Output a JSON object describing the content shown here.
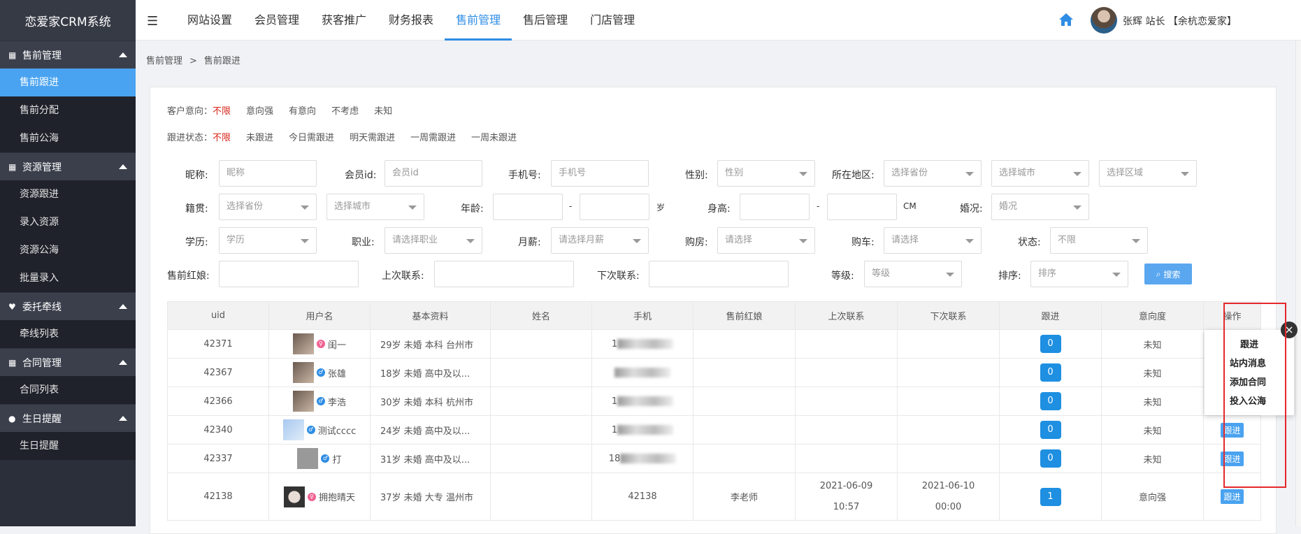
{
  "brand": "恋爱家CRM系统",
  "sidebar": {
    "groups": [
      {
        "label": "售前管理",
        "items": [
          "售前跟进",
          "售前分配",
          "售前公海"
        ]
      },
      {
        "label": "资源管理",
        "items": [
          "资源跟进",
          "录入资源",
          "资源公海",
          "批量录入"
        ]
      },
      {
        "label": "委托牵线",
        "items": [
          "牵线列表"
        ]
      },
      {
        "label": "合同管理",
        "items": [
          "合同列表"
        ]
      },
      {
        "label": "生日提醒",
        "items": [
          "生日提醒"
        ]
      }
    ]
  },
  "topnav": {
    "items": [
      "网站设置",
      "会员管理",
      "获客推广",
      "财务报表",
      "售前管理",
      "售后管理",
      "门店管理"
    ],
    "active_index": 4,
    "user": "张辉 站长 【余杭恋爱家】"
  },
  "breadcrumb": {
    "parent": "售前管理",
    "separator": ">",
    "current": "售前跟进"
  },
  "filters": {
    "intent": {
      "label": "客户意向：",
      "options": [
        "不限",
        "意向强",
        "有意向",
        "不考虑",
        "未知"
      ]
    },
    "status": {
      "label": "跟进状态：",
      "options": [
        "不限",
        "未跟进",
        "今日需跟进",
        "明天需跟进",
        "一周需跟进",
        "一周未跟进"
      ]
    }
  },
  "form": {
    "nickname": {
      "label": "昵称:",
      "placeholder": "昵称"
    },
    "member_id": {
      "label": "会员id:",
      "placeholder": "会员id"
    },
    "phone": {
      "label": "手机号:",
      "placeholder": "手机号"
    },
    "gender": {
      "label": "性别:",
      "value": "性别"
    },
    "region": {
      "label": "所在地区:",
      "province": "选择省份",
      "city": "选择城市",
      "district": "选择区域"
    },
    "native": {
      "label": "籍贯:",
      "province": "选择省份",
      "city": "选择城市"
    },
    "age": {
      "label": "年龄:",
      "dash": "-",
      "unit": "岁"
    },
    "height": {
      "label": "身高:",
      "dash": "-",
      "unit": "CM"
    },
    "marriage": {
      "label": "婚况:",
      "value": "婚况"
    },
    "education": {
      "label": "学历:",
      "value": "学历"
    },
    "job": {
      "label": "职业:",
      "value": "请选择职业"
    },
    "salary": {
      "label": "月薪:",
      "value": "请选择月薪"
    },
    "house": {
      "label": "购房:",
      "value": "请选择"
    },
    "car": {
      "label": "购车:",
      "value": "请选择"
    },
    "state": {
      "label": "状态:",
      "value": "不限"
    },
    "matchmaker": {
      "label": "售前红娘:"
    },
    "last_contact": {
      "label": "上次联系:"
    },
    "next_contact": {
      "label": "下次联系:"
    },
    "level": {
      "label": "等级:",
      "value": "等级"
    },
    "sort": {
      "label": "排序:",
      "value": "排序"
    },
    "search_label": "搜索"
  },
  "table": {
    "headers": [
      "uid",
      "用户名",
      "基本资料",
      "姓名",
      "手机",
      "售前红娘",
      "上次联系",
      "下次联系",
      "跟进",
      "意向度",
      "操作"
    ],
    "rows": [
      {
        "uid": "42371",
        "name": "闺一",
        "gender": "f",
        "info": "29岁 未婚 本科 台州市",
        "phone": "1",
        "matchmaker": "",
        "last": "",
        "next": "",
        "follow": "0",
        "intent": "未知",
        "op": ""
      },
      {
        "uid": "42367",
        "name": "张雄",
        "gender": "m",
        "info": "18岁 未婚 高中及以...",
        "phone": "",
        "matchmaker": "",
        "last": "",
        "next": "",
        "follow": "0",
        "intent": "未知",
        "op": ""
      },
      {
        "uid": "42366",
        "name": "李浩",
        "gender": "m",
        "info": "30岁 未婚 本科 杭州市",
        "phone": "1",
        "matchmaker": "",
        "last": "",
        "next": "",
        "follow": "0",
        "intent": "未知",
        "op": ""
      },
      {
        "uid": "42340",
        "name": "测试cccc",
        "gender": "m",
        "info": "24岁 未婚 高中及以...",
        "phone": "1",
        "matchmaker": "",
        "last": "",
        "next": "",
        "follow": "0",
        "intent": "未知",
        "op": "跟进"
      },
      {
        "uid": "42337",
        "name": "打",
        "gender": "m",
        "info": "31岁 未婚 高中及以...",
        "phone": "18",
        "matchmaker": "",
        "last": "",
        "next": "",
        "follow": "0",
        "intent": "未知",
        "op": "跟进"
      },
      {
        "uid": "42138",
        "name": "拥抱晴天",
        "gender": "f",
        "info": "37岁 未婚 大专 温州市",
        "phone": "42138",
        "matchmaker": "李老师",
        "last": "2021-06-09 10:57",
        "next": "2021-06-10 00:00",
        "follow": "1",
        "intent": "意向强",
        "op": "跟进"
      }
    ]
  },
  "popup": {
    "items": [
      "跟进",
      "站内消息",
      "添加合同",
      "投入公海"
    ],
    "close": "×"
  },
  "colors": {
    "accent": "#2f8de4",
    "sidebar": "#2b2f3a",
    "selected_filter": "#d7261a",
    "highlight": "#e5282a"
  }
}
